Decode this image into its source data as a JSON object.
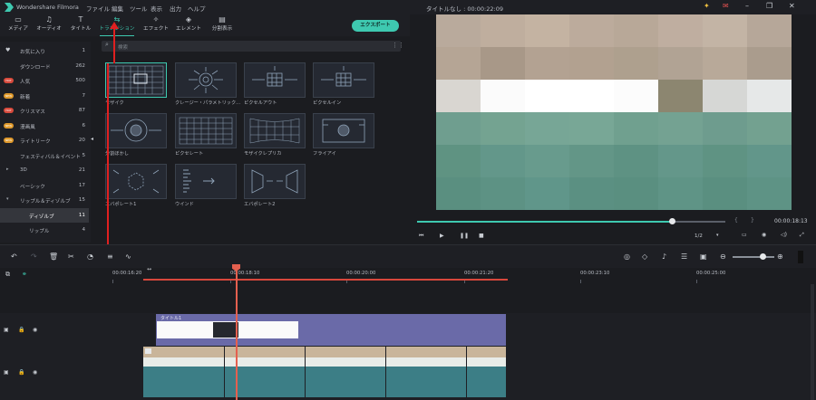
{
  "titlebar": {
    "app_name": "Wondershare Filmora",
    "menu": [
      "ファイル",
      "編集",
      "ツール",
      "表示",
      "出力",
      "ヘルプ"
    ],
    "document_title": "タイトルなし : 00:00:22:09",
    "icons": [
      "bulb-icon",
      "mail-icon",
      "minimize-icon",
      "restore-icon",
      "close-icon"
    ]
  },
  "toolbar": {
    "tabs": [
      {
        "label": "メディア",
        "icon": "folder-icon"
      },
      {
        "label": "オーディオ",
        "icon": "music-icon"
      },
      {
        "label": "タイトル",
        "icon": "text-icon"
      },
      {
        "label": "トランジション",
        "icon": "transition-icon",
        "active": true
      },
      {
        "label": "エフェクト",
        "icon": "effect-icon"
      },
      {
        "label": "エレメント",
        "icon": "element-icon"
      },
      {
        "label": "分割表示",
        "icon": "split-screen-icon"
      }
    ],
    "export_label": "エクスポート"
  },
  "categories": [
    {
      "label": "お気に入り",
      "count": "1",
      "icon": "heart-icon"
    },
    {
      "label": "ダウンロード",
      "count": "262"
    },
    {
      "label": "人気",
      "count": "500",
      "badge": "HOT"
    },
    {
      "label": "新着",
      "count": "7",
      "badge": "NEW"
    },
    {
      "label": "クリスマス",
      "count": "87",
      "badge": "HOT"
    },
    {
      "label": "漫画風",
      "count": "6",
      "badge": "NEW"
    },
    {
      "label": "ライトリーク",
      "count": "20",
      "badge": "NEW"
    },
    {
      "label": "フェスティバル＆イベント",
      "count": "5"
    },
    {
      "label": "3D",
      "count": "21",
      "arrow": "▸"
    },
    {
      "label": "ベーシック",
      "count": "17"
    },
    {
      "label": "リップル＆ディゾルブ",
      "count": "15",
      "arrow": "▾"
    },
    {
      "label": "ディゾルブ",
      "count": "11",
      "selected": true
    },
    {
      "label": "リップル",
      "count": "4"
    }
  ],
  "search": {
    "placeholder": "検索"
  },
  "transitions": [
    {
      "label": "モザイク",
      "selected": true
    },
    {
      "label": "クレージー・パラメトリック..."
    },
    {
      "label": "ピクセルアウト"
    },
    {
      "label": "ピクセルイン"
    },
    {
      "label": "分割ぼかし"
    },
    {
      "label": "ピクセレート"
    },
    {
      "label": "モザイクレプリカ"
    },
    {
      "label": "フライアイ"
    },
    {
      "label": "エバポレート1"
    },
    {
      "label": "ウインド"
    },
    {
      "label": "エバポレート2"
    }
  ],
  "preview": {
    "timecode": "00:00:18:13",
    "zoom": "1/2",
    "progress": 0.826
  },
  "timeline": {
    "ruler": [
      "00:00:16:20",
      "00:00:18:10",
      "00:00:20:00",
      "00:00:21:20",
      "00:00:23:10",
      "00:00:25:00"
    ],
    "title_clip_label": "タイトル1"
  },
  "colors": {
    "accent": "#3ec9b0",
    "playhead": "#e4604f",
    "title_clip": "#6a6aa8",
    "annotation": "#e02020"
  }
}
